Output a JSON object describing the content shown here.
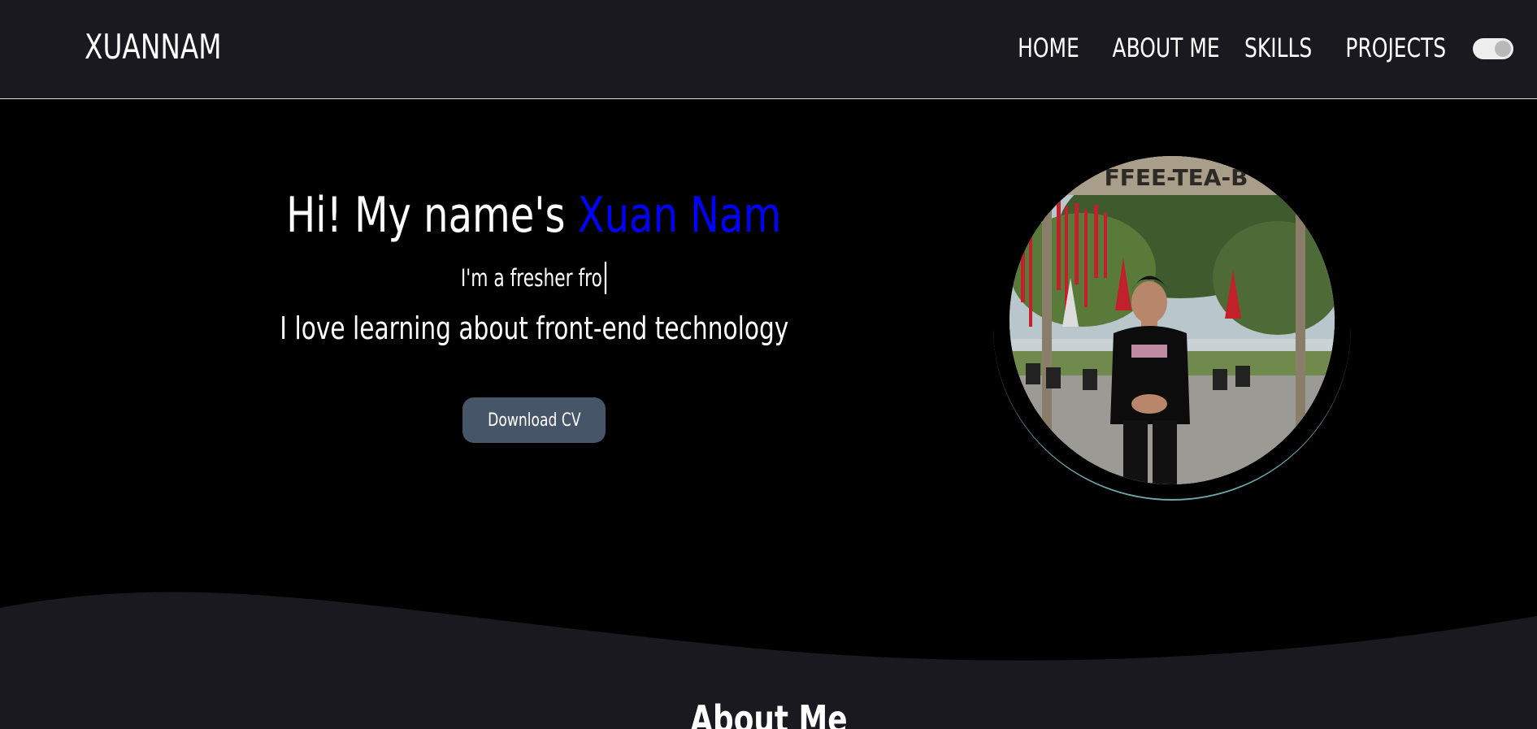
{
  "header": {
    "logo": "XUANNAM",
    "nav": [
      {
        "label": "HOME"
      },
      {
        "label": "ABOUT ME"
      },
      {
        "label": "SKILLS"
      },
      {
        "label": "PROJECTS"
      }
    ],
    "theme_toggle": {
      "state": "on"
    }
  },
  "hero": {
    "greeting": "Hi! My name's ",
    "name": "Xuan Nam",
    "typed_text": "I'm a fresher fro",
    "tagline": "I love learning about front-end technology",
    "cv_button": "Download CV",
    "photo": {
      "sign_text": "FFEE-TEA-B"
    }
  },
  "about": {
    "heading": "About Me"
  },
  "colors": {
    "header_bg": "#1a1920",
    "page_bg": "#000000",
    "accent_name": "#0000ff",
    "button_bg": "#475569",
    "section_bg": "#1a1920"
  }
}
